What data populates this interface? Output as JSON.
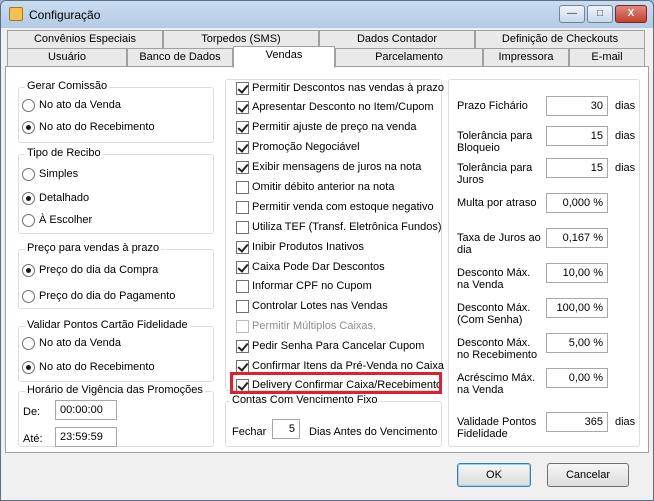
{
  "window": {
    "title": "Configuração",
    "minimize_glyph": "—",
    "maximize_glyph": "□",
    "close_glyph": "X"
  },
  "tabs_back": [
    "Convênios Especiais",
    "Torpedos (SMS)",
    "Dados Contador",
    "Definição de Checkouts"
  ],
  "tabs_front": [
    "Usuário",
    "Banco de Dados",
    "Vendas",
    "Parcelamento",
    "Impressora",
    "E-mail"
  ],
  "active_tab": "Vendas",
  "gerar_comissao": {
    "title": "Gerar Comissão",
    "options": [
      "No ato da Venda",
      "No ato do Recebimento"
    ],
    "selected": 1
  },
  "tipo_recibo": {
    "title": "Tipo de Recibo",
    "options": [
      "Simples",
      "Detalhado",
      "À Escolher"
    ],
    "selected": 1
  },
  "preco_prazo": {
    "title": "Preço para vendas à prazo",
    "options": [
      "Preço do dia da Compra",
      "Preço do dia do Pagamento"
    ],
    "selected": 0
  },
  "validar_pontos": {
    "title": "Validar Pontos Cartão Fidelidade",
    "options": [
      "No ato da Venda",
      "No ato do Recebimento"
    ],
    "selected": 1
  },
  "horario_vigencia": {
    "title": "Horário de Vigência das Promoções",
    "de_label": "De:",
    "de_value": "00:00:00",
    "ate_label": "Até:",
    "ate_value": "23:59:59"
  },
  "checkboxes": [
    {
      "label": "Permitir Descontos nas vendas à prazo",
      "checked": true
    },
    {
      "label": "Apresentar Desconto no Item/Cupom",
      "checked": true
    },
    {
      "label": "Permitir ajuste de preço na venda",
      "checked": true
    },
    {
      "label": "Promoção Negociável",
      "checked": true
    },
    {
      "label": "Exibir mensagens de juros na nota",
      "checked": true
    },
    {
      "label": "Omitir débito anterior na nota",
      "checked": false
    },
    {
      "label": "Permitir venda com estoque negativo",
      "checked": false
    },
    {
      "label": "Utiliza TEF (Transf. Eletrônica Fundos)",
      "checked": false
    },
    {
      "label": "Inibir Produtos Inativos",
      "checked": true
    },
    {
      "label": "Caixa Pode Dar Descontos",
      "checked": true
    },
    {
      "label": "Informar CPF no Cupom",
      "checked": false
    },
    {
      "label": "Controlar Lotes nas Vendas",
      "checked": false
    },
    {
      "label": "Permitir Múltiplos Caixas.",
      "checked": false,
      "disabled": true
    },
    {
      "label": "Pedir Senha Para Cancelar Cupom",
      "checked": true
    },
    {
      "label": "Confirmar Itens da Pré-Venda no Caixa",
      "checked": true
    },
    {
      "label": "Delivery Confirmar Caixa/Recebimento",
      "checked": true
    }
  ],
  "contas_vencimento": {
    "title": "Contas Com Vencimento Fixo",
    "fechar_label": "Fechar",
    "dias_value": "5",
    "suffix": "Dias Antes do Vencimento"
  },
  "right_fields": [
    {
      "label": "Prazo Fichário",
      "value": "30",
      "unit": "dias"
    },
    {
      "label": "Tolerância para Bloqueio",
      "value": "15",
      "unit": "dias"
    },
    {
      "label": "Tolerância para Juros",
      "value": "15",
      "unit": "dias"
    },
    {
      "label": "Multa por atraso",
      "value": "0,000 %",
      "unit": ""
    },
    {
      "label": "Taxa de Juros ao dia",
      "value": "0,167 %",
      "unit": ""
    },
    {
      "label": "Desconto Máx. na Venda",
      "value": "10,00 %",
      "unit": ""
    },
    {
      "label": "Desconto Máx. (Com Senha)",
      "value": "100,00 %",
      "unit": ""
    },
    {
      "label": "Desconto Máx. no Recebimento",
      "value": "5,00 %",
      "unit": ""
    },
    {
      "label": "Acréscimo Máx. na Venda",
      "value": "0,00 %",
      "unit": ""
    },
    {
      "label": "Validade Pontos Fidelidade",
      "value": "365",
      "unit": "dias"
    }
  ],
  "buttons": {
    "ok": "OK",
    "cancel": "Cancelar"
  }
}
